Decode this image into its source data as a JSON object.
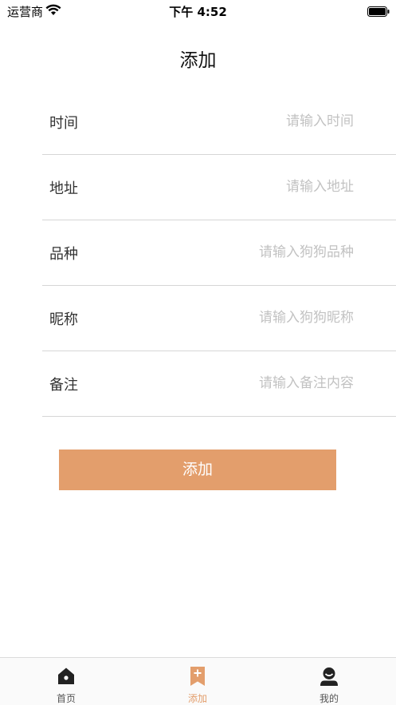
{
  "status_bar": {
    "carrier": "运营商",
    "time": "下午 4:52"
  },
  "nav": {
    "title": "添加"
  },
  "form": {
    "fields": [
      {
        "label": "时间",
        "placeholder": "请输入时间",
        "value": ""
      },
      {
        "label": "地址",
        "placeholder": "请输入地址",
        "value": ""
      },
      {
        "label": "品种",
        "placeholder": "请输入狗狗品种",
        "value": ""
      },
      {
        "label": "昵称",
        "placeholder": "请输入狗狗昵称",
        "value": ""
      },
      {
        "label": "备注",
        "placeholder": "请输入备注内容",
        "value": ""
      }
    ],
    "submit_label": "添加"
  },
  "tab_bar": {
    "tabs": [
      {
        "label": "首页",
        "icon": "home-icon",
        "active": false
      },
      {
        "label": "添加",
        "icon": "add-bookmark-icon",
        "active": true
      },
      {
        "label": "我的",
        "icon": "user-icon",
        "active": false
      }
    ]
  },
  "colors": {
    "accent": "#e39e6c",
    "placeholder": "#c2c2c2",
    "divider": "#d6d6d6",
    "tab_inactive_icon": "#222222"
  }
}
